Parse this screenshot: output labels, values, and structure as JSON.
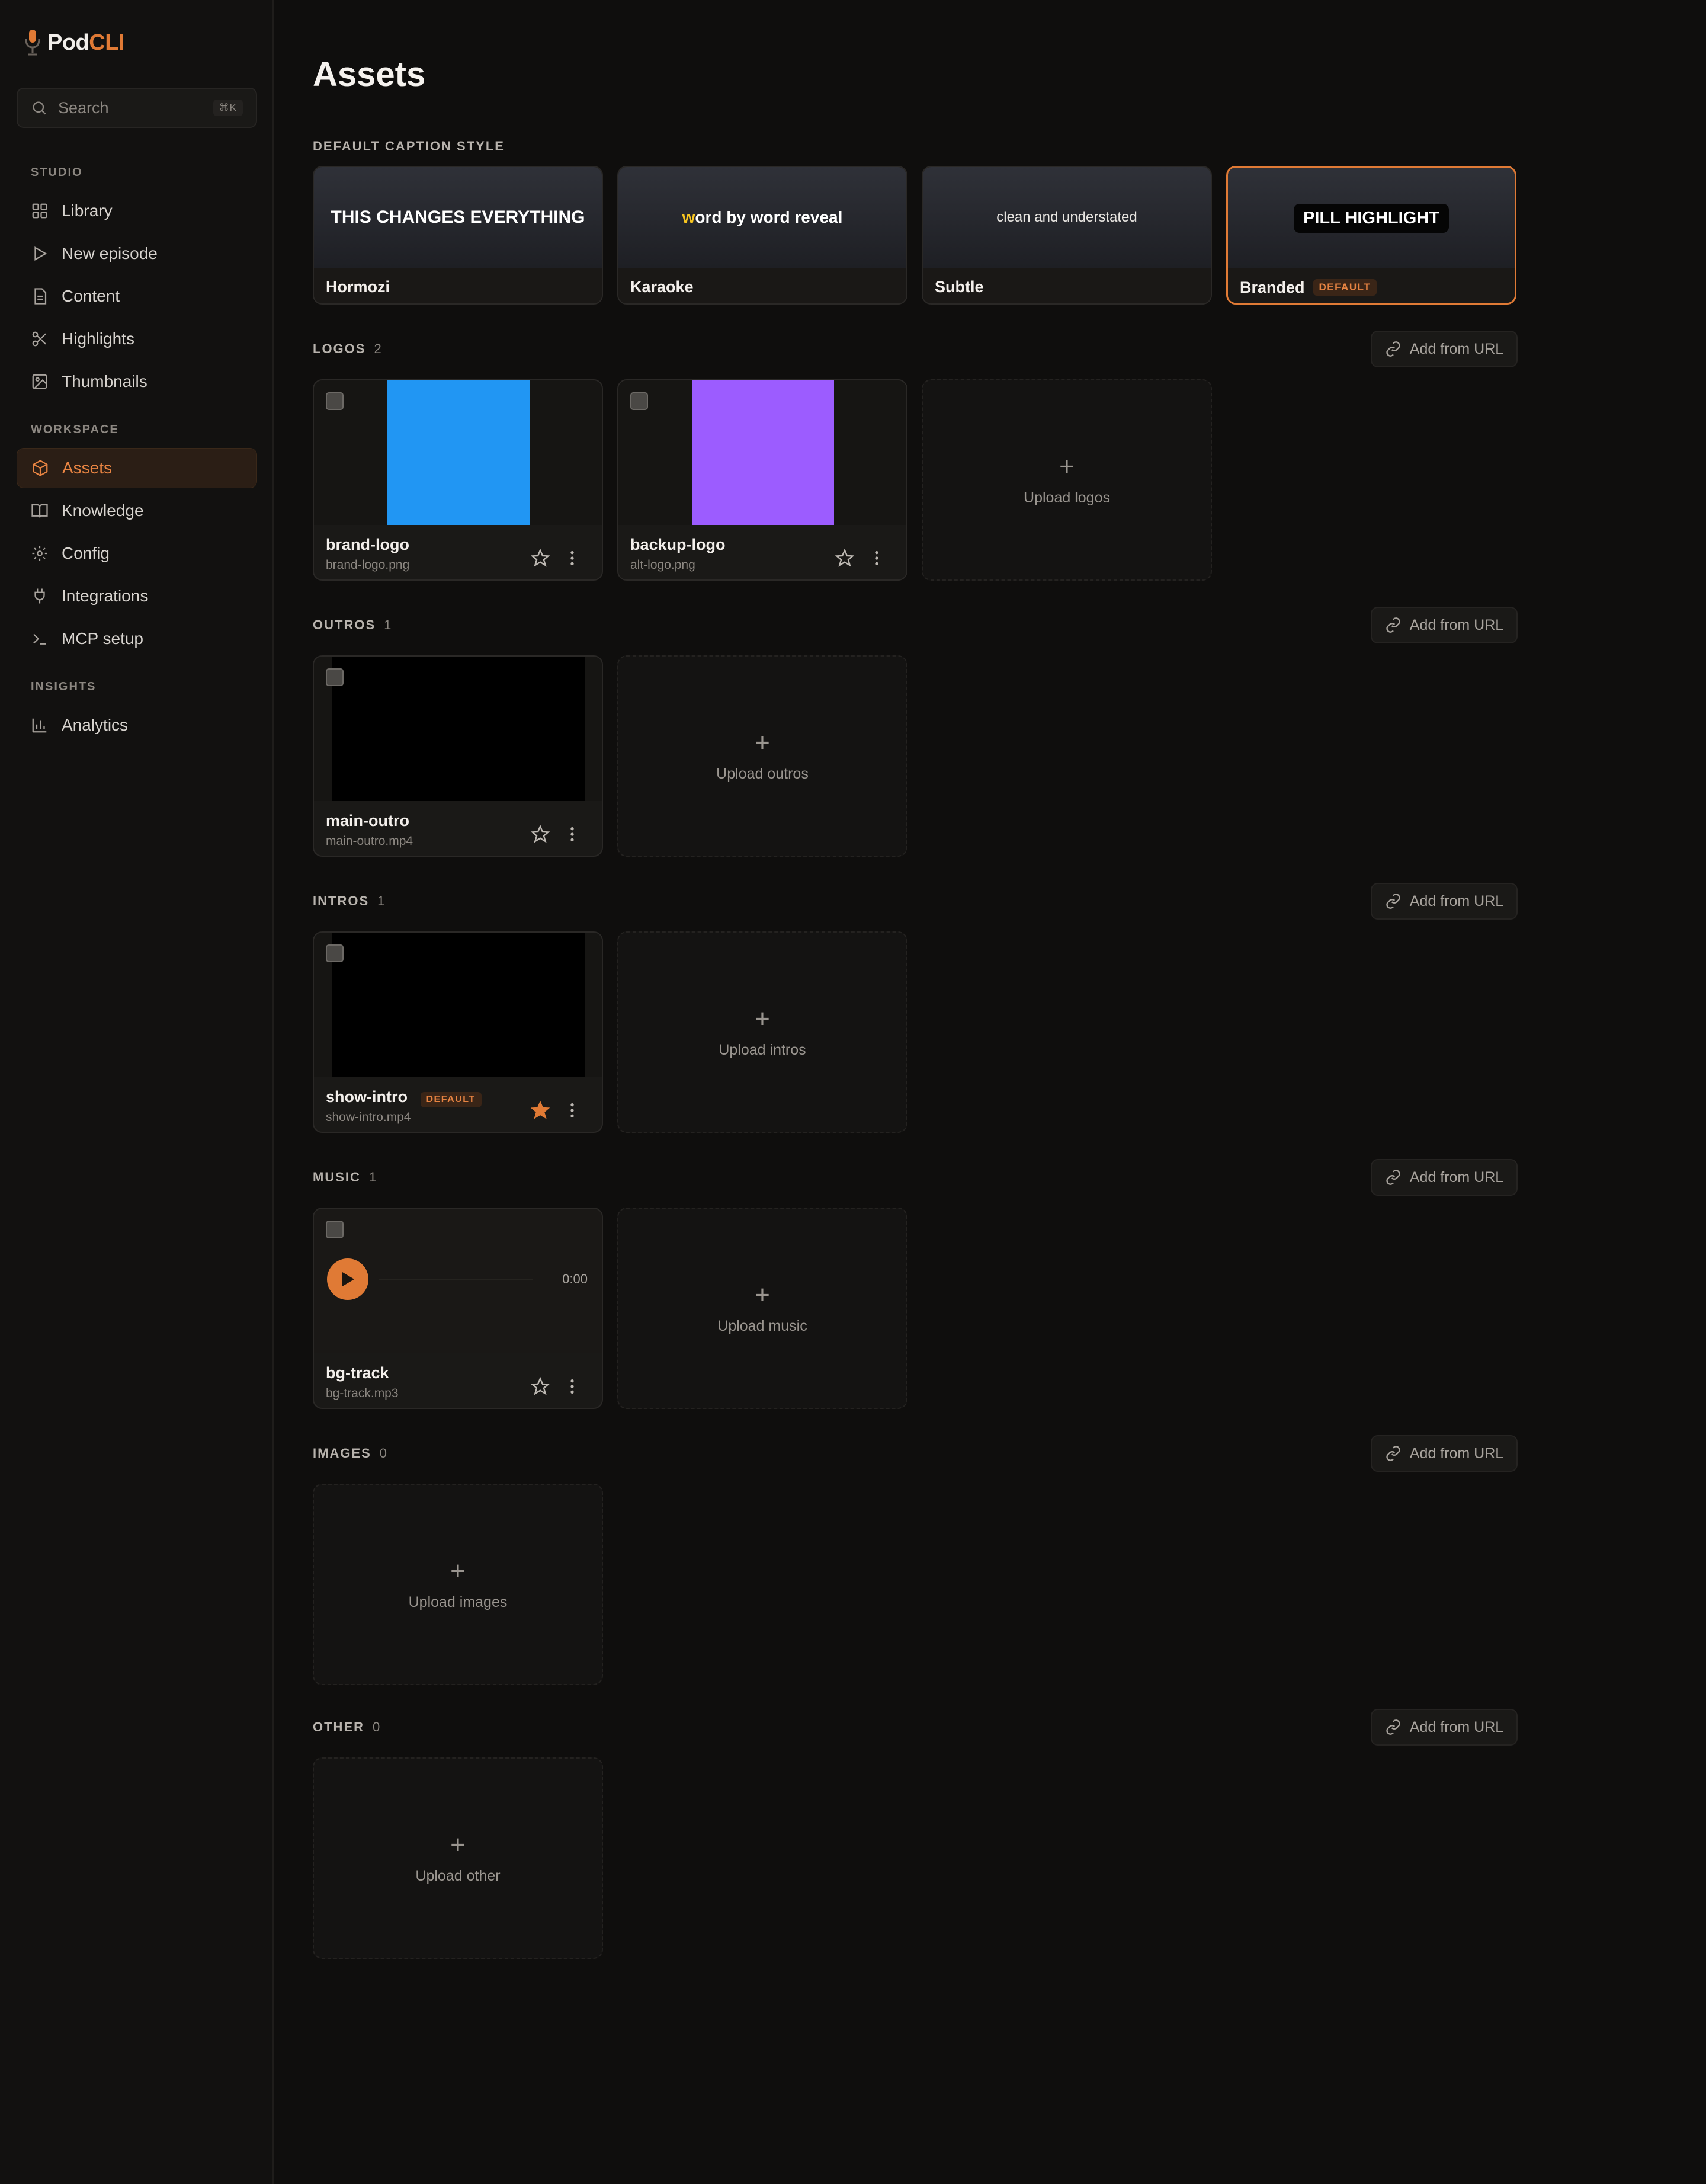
{
  "app": {
    "name_part1": "Pod",
    "name_part2": "CLI"
  },
  "search": {
    "placeholder": "Search",
    "shortcut": "⌘K"
  },
  "sidebar": {
    "sections": [
      {
        "title": "STUDIO",
        "items": [
          {
            "label": "Library",
            "icon": "grid-icon"
          },
          {
            "label": "New episode",
            "icon": "play-icon"
          },
          {
            "label": "Content",
            "icon": "document-icon"
          },
          {
            "label": "Highlights",
            "icon": "scissors-icon"
          },
          {
            "label": "Thumbnails",
            "icon": "image-icon"
          }
        ]
      },
      {
        "title": "WORKSPACE",
        "items": [
          {
            "label": "Assets",
            "icon": "box-icon",
            "active": true
          },
          {
            "label": "Knowledge",
            "icon": "book-icon"
          },
          {
            "label": "Config",
            "icon": "gear-icon"
          },
          {
            "label": "Integrations",
            "icon": "plug-icon"
          },
          {
            "label": "MCP setup",
            "icon": "terminal-icon"
          }
        ]
      },
      {
        "title": "INSIGHTS",
        "items": [
          {
            "label": "Analytics",
            "icon": "bar-chart-icon"
          }
        ]
      }
    ]
  },
  "page": {
    "title": "Assets"
  },
  "caption_styles": {
    "label": "DEFAULT CAPTION STYLE",
    "items": [
      {
        "name": "Hormozi",
        "preview": "THIS CHANGES EVERYTHING"
      },
      {
        "name": "Karaoke",
        "preview_highlight": "w",
        "preview_rest": "ord by word reveal"
      },
      {
        "name": "Subtle",
        "preview": "clean and understated"
      },
      {
        "name": "Branded",
        "preview": "PILL HIGHLIGHT",
        "badge": "DEFAULT",
        "selected": true
      }
    ]
  },
  "add_from_url": "Add from URL",
  "sections": {
    "logos": {
      "label": "LOGOS",
      "count": "2",
      "upload": "Upload logos",
      "items": [
        {
          "title": "brand-logo",
          "file": "brand-logo.png",
          "color": "#2196f3"
        },
        {
          "title": "backup-logo",
          "file": "alt-logo.png",
          "color": "#9c5cff"
        }
      ]
    },
    "outros": {
      "label": "OUTROS",
      "count": "1",
      "upload": "Upload outros",
      "items": [
        {
          "title": "main-outro",
          "file": "main-outro.mp4"
        }
      ]
    },
    "intros": {
      "label": "INTROS",
      "count": "1",
      "upload": "Upload intros",
      "items": [
        {
          "title": "show-intro",
          "file": "show-intro.mp4",
          "badge": "DEFAULT",
          "starred": true
        }
      ]
    },
    "music": {
      "label": "MUSIC",
      "count": "1",
      "upload": "Upload music",
      "items": [
        {
          "title": "bg-track",
          "file": "bg-track.mp3",
          "time": "0:00"
        }
      ]
    },
    "images": {
      "label": "IMAGES",
      "count": "0",
      "upload": "Upload images"
    },
    "other": {
      "label": "OTHER",
      "count": "0",
      "upload": "Upload other"
    }
  },
  "colors": {
    "accent": "#e07a35",
    "background": "#0f0e0d"
  }
}
